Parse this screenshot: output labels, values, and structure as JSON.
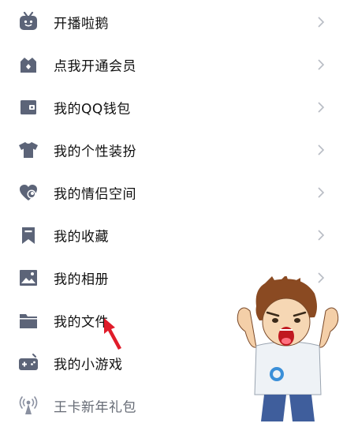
{
  "colors": {
    "icon": "#5c6478",
    "text": "#111111",
    "faded_text": "#666b75",
    "chevron": "#b8bcc4",
    "arrow": "#e01c2a"
  },
  "menu": {
    "items": [
      {
        "label": "开播啦鹅",
        "icon": "tv-icon"
      },
      {
        "label": "点我开通会员",
        "icon": "crown-icon"
      },
      {
        "label": "我的QQ钱包",
        "icon": "wallet-icon"
      },
      {
        "label": "我的个性装扮",
        "icon": "shirt-icon"
      },
      {
        "label": "我的情侣空间",
        "icon": "heart-icon"
      },
      {
        "label": "我的收藏",
        "icon": "bookmark-icon"
      },
      {
        "label": "我的相册",
        "icon": "photo-icon"
      },
      {
        "label": "我的文件",
        "icon": "folder-icon"
      },
      {
        "label": "我的小游戏",
        "icon": "gamepad-icon"
      },
      {
        "label": "王卡新年礼包",
        "icon": "signal-tower-icon"
      }
    ]
  }
}
